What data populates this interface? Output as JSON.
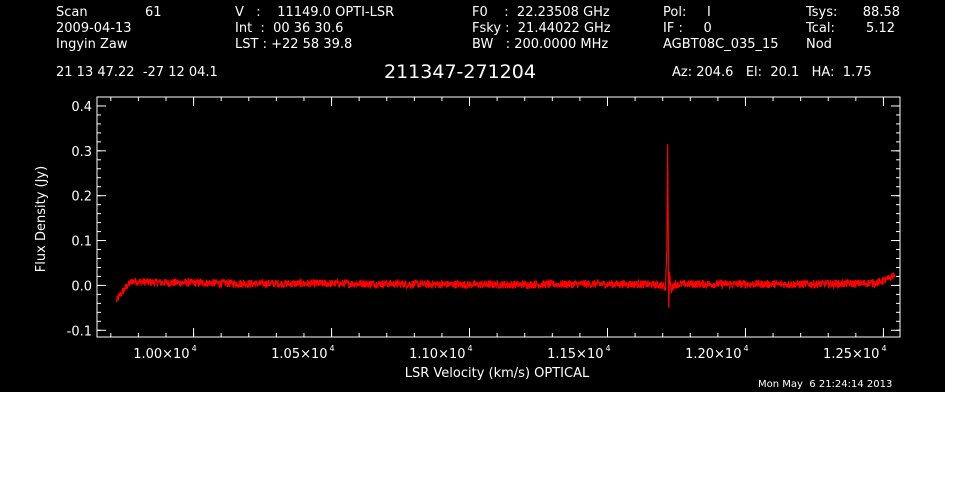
{
  "header": {
    "scan_label": "Scan",
    "scan_number": "61",
    "date": "2009-04-13",
    "observer": "Ingyin Zaw",
    "velocity": "V   :    11149.0 OPTI-LSR",
    "integration": "Int  :  00 36 30.6",
    "lst": "LST : +22 58 39.8",
    "f0": "F0    :  22.23508 GHz",
    "fsky": "Fsky :  21.44022 GHz",
    "bw": "BW   : 200.0000 MHz",
    "pol": "Pol:     I",
    "if_num": "IF :     0",
    "project": "AGBT08C_035_15",
    "tsys_label": "Tsys:",
    "tsys_value": "88.58",
    "tcal_label": "Tcal:",
    "tcal_value": "5.12",
    "proc": "Nod",
    "coords": "21 13 47.22  -27 12 04.1",
    "source": "211347-271204",
    "azelha": "Az: 204.6   El:  20.1   HA:  1.75",
    "timestamp": "Mon May  6 21:24:14 2013"
  },
  "chart_data": {
    "type": "line",
    "title": "211347-271204",
    "xlabel": "LSR Velocity (km/s) OPTICAL",
    "ylabel": "Flux Density (Jy)",
    "xlim": [
      9650,
      12560
    ],
    "ylim": [
      -0.115,
      0.42
    ],
    "x_ticks": [
      {
        "value": 10000,
        "mantissa": "1.00",
        "exp": "4"
      },
      {
        "value": 10500,
        "mantissa": "1.05",
        "exp": "4"
      },
      {
        "value": 11000,
        "mantissa": "1.10",
        "exp": "4"
      },
      {
        "value": 11500,
        "mantissa": "1.15",
        "exp": "4"
      },
      {
        "value": 12000,
        "mantissa": "1.20",
        "exp": "4"
      },
      {
        "value": 12500,
        "mantissa": "1.25",
        "exp": "4"
      }
    ],
    "y_ticks": [
      {
        "value": 0.4,
        "label": "0.4"
      },
      {
        "value": 0.3,
        "label": "0.3"
      },
      {
        "value": 0.2,
        "label": "0.2"
      },
      {
        "value": 0.1,
        "label": "0.1"
      },
      {
        "value": 0.0,
        "label": "0.0"
      },
      {
        "value": -0.1,
        "label": "-0.1"
      }
    ],
    "grid": false,
    "series": [
      {
        "color": "#ff0000",
        "x": [
          9720,
          9730,
          9745,
          9760,
          9780,
          9800,
          9900,
          10000,
          10200,
          10400,
          10600,
          10800,
          11000,
          11200,
          11400,
          11600,
          11660,
          11700,
          11710,
          11715,
          11718,
          11722,
          11725,
          11730,
          11740,
          11780,
          11850,
          12000,
          12200,
          12400,
          12480,
          12520,
          12540
        ],
        "y": [
          -0.035,
          -0.025,
          -0.012,
          0.0,
          0.01,
          0.008,
          0.006,
          0.006,
          0.004,
          0.004,
          0.004,
          0.003,
          0.002,
          0.002,
          0.003,
          0.003,
          0.002,
          0.0,
          -0.01,
          0.08,
          0.315,
          -0.05,
          0.03,
          -0.012,
          0.002,
          0.003,
          0.003,
          0.003,
          0.003,
          0.004,
          0.006,
          0.015,
          0.025
        ]
      }
    ]
  }
}
